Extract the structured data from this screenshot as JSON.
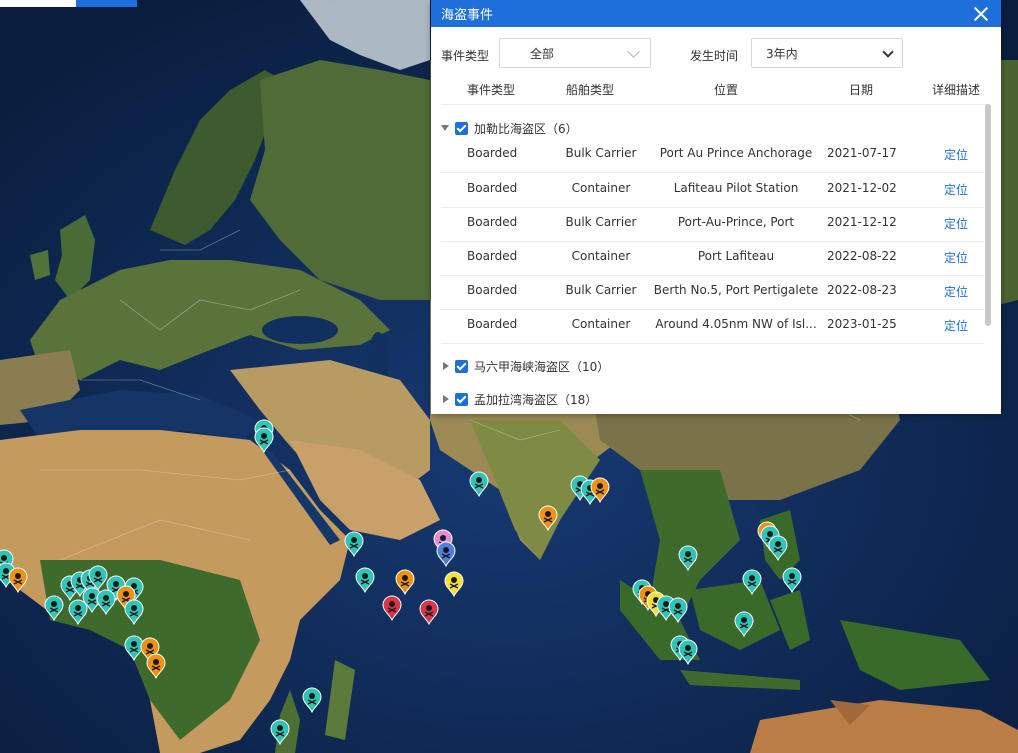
{
  "panel": {
    "title": "海盗事件",
    "filter_type_label": "事件类型",
    "filter_type_value": "全部",
    "filter_time_label": "发生时间",
    "filter_time_value": "3年内",
    "headers": [
      "事件类型",
      "船舶类型",
      "位置",
      "日期",
      "详细描述"
    ]
  },
  "groups": [
    {
      "name": "加勒比海盗区（6）",
      "expanded": true,
      "rows": [
        {
          "type": "Boarded",
          "ship": "Bulk Carrier",
          "location": "Port Au Prince Anchorage",
          "date": "2021-07-17",
          "action": "定位"
        },
        {
          "type": "Boarded",
          "ship": "Container",
          "location": "Lafiteau Pilot Station",
          "date": "2021-12-02",
          "action": "定位"
        },
        {
          "type": "Boarded",
          "ship": "Bulk Carrier",
          "location": "Port-Au-Prince, Port",
          "date": "2021-12-12",
          "action": "定位"
        },
        {
          "type": "Boarded",
          "ship": "Container",
          "location": "Port Lafiteau",
          "date": "2022-08-22",
          "action": "定位"
        },
        {
          "type": "Boarded",
          "ship": "Bulk Carrier",
          "location": "Berth No.5, Port Pertigalete",
          "date": "2022-08-23",
          "action": "定位"
        },
        {
          "type": "Boarded",
          "ship": "Container",
          "location": "Around 4.05nm NW of Isl...",
          "date": "2023-01-25",
          "action": "定位"
        }
      ]
    },
    {
      "name": "马六甲海峡海盗区（10）",
      "expanded": false
    },
    {
      "name": "孟加拉湾海盗区（18）",
      "expanded": false
    }
  ],
  "map_markers": {
    "colors": {
      "teal": "#2ec4b6",
      "orange": "#f0920f",
      "red": "#d9364a",
      "yellow": "#f5e03a",
      "pink": "#e58ad8",
      "blue": "#4f7fe0"
    },
    "icon": "skull-crossbones-icon"
  }
}
